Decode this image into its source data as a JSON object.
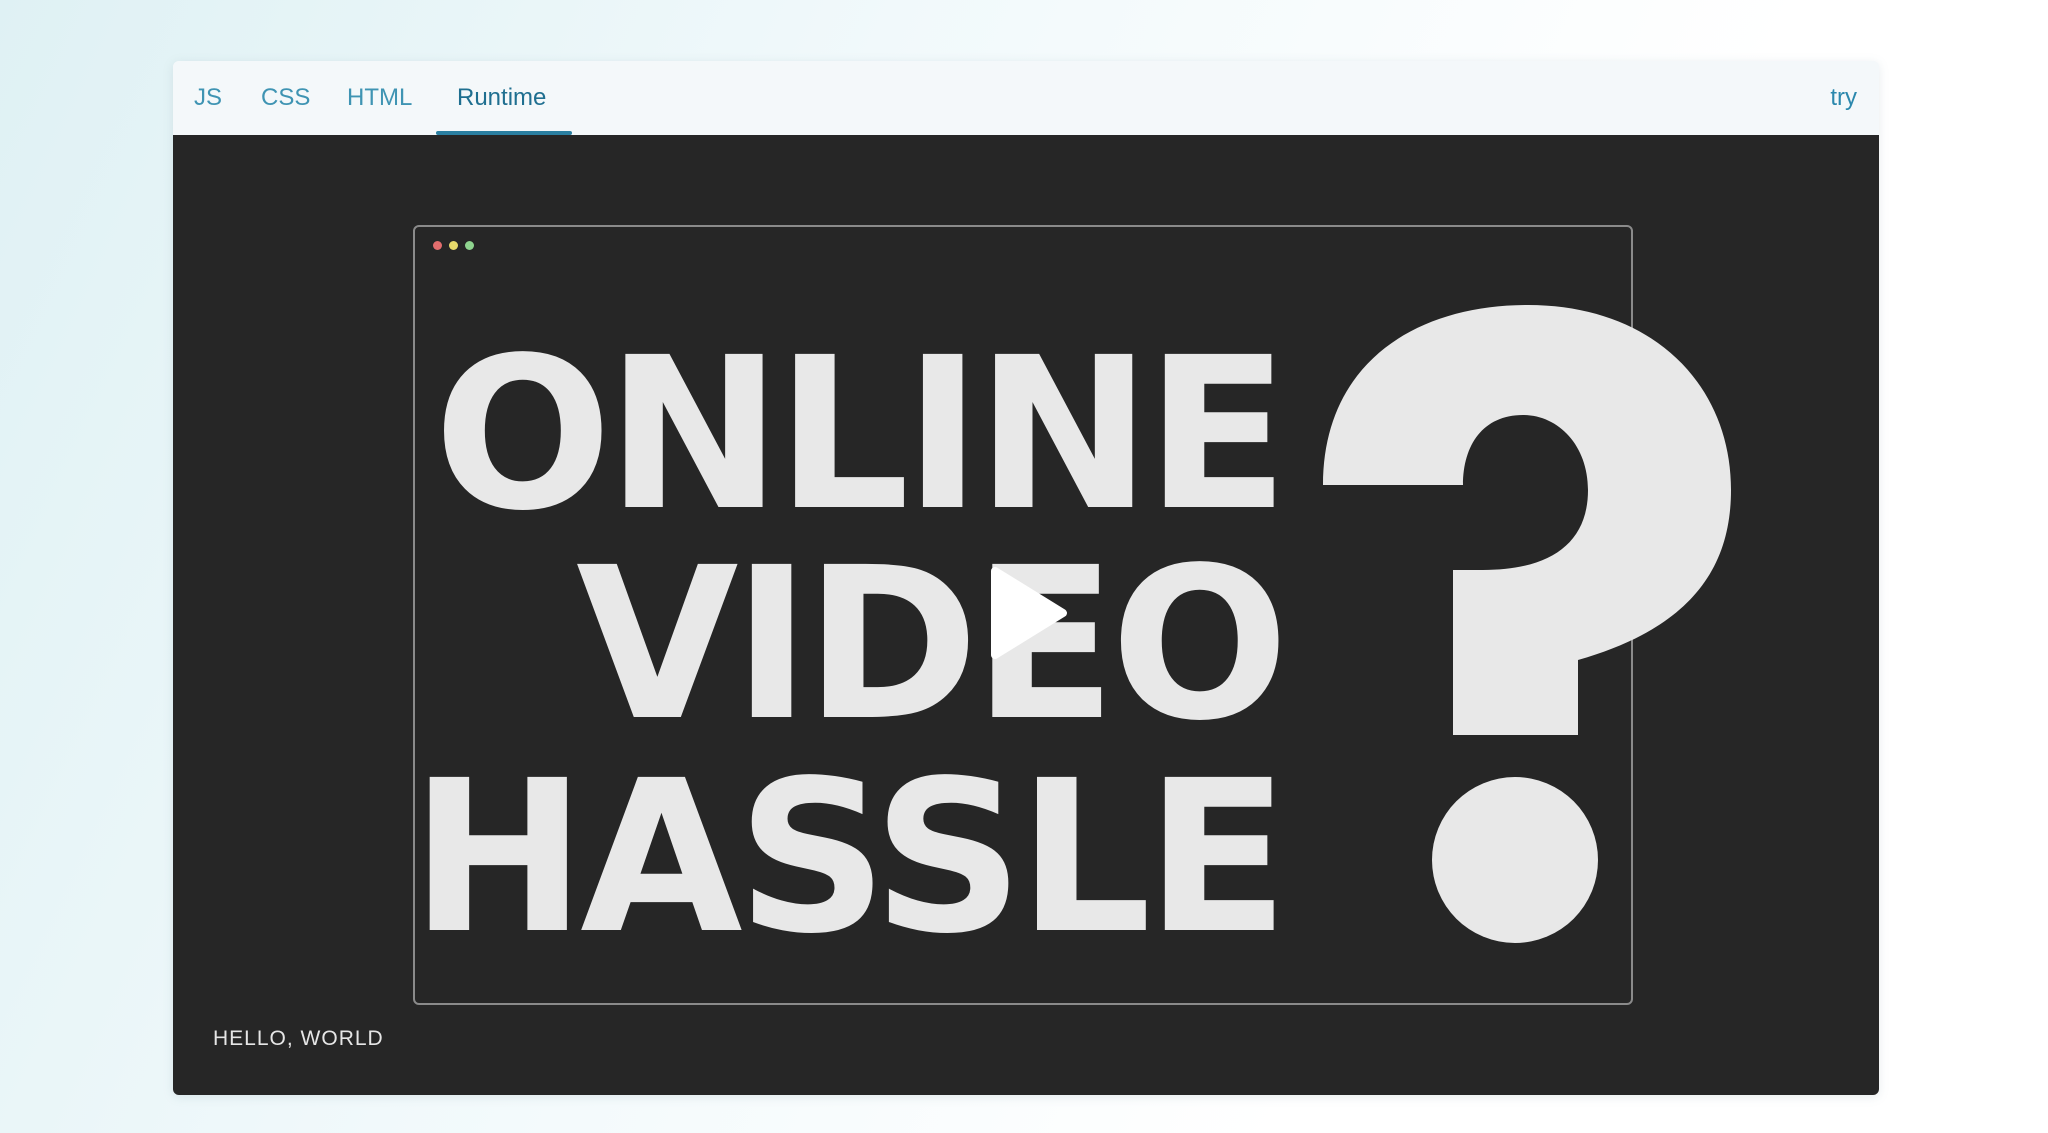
{
  "tabs": [
    {
      "label": "JS"
    },
    {
      "label": "CSS"
    },
    {
      "label": "HTML"
    },
    {
      "label": "Runtime"
    }
  ],
  "active_tab": "Runtime",
  "try_label": "try",
  "video": {
    "title_lines": [
      "ONLINE",
      "VIDEO",
      "HASSLE"
    ],
    "question_glyph": "question-mark-graphic",
    "play_icon": "play-icon",
    "window_dots": [
      "#e26d6d",
      "#e6d96b",
      "#8fd48f"
    ]
  },
  "output_text": "HELLO, WORLD",
  "colors": {
    "accent": "#2a7fa1",
    "tab_text": "#3f94b3",
    "runtime_bg": "#262626",
    "video_text": "#e8e8e8"
  }
}
